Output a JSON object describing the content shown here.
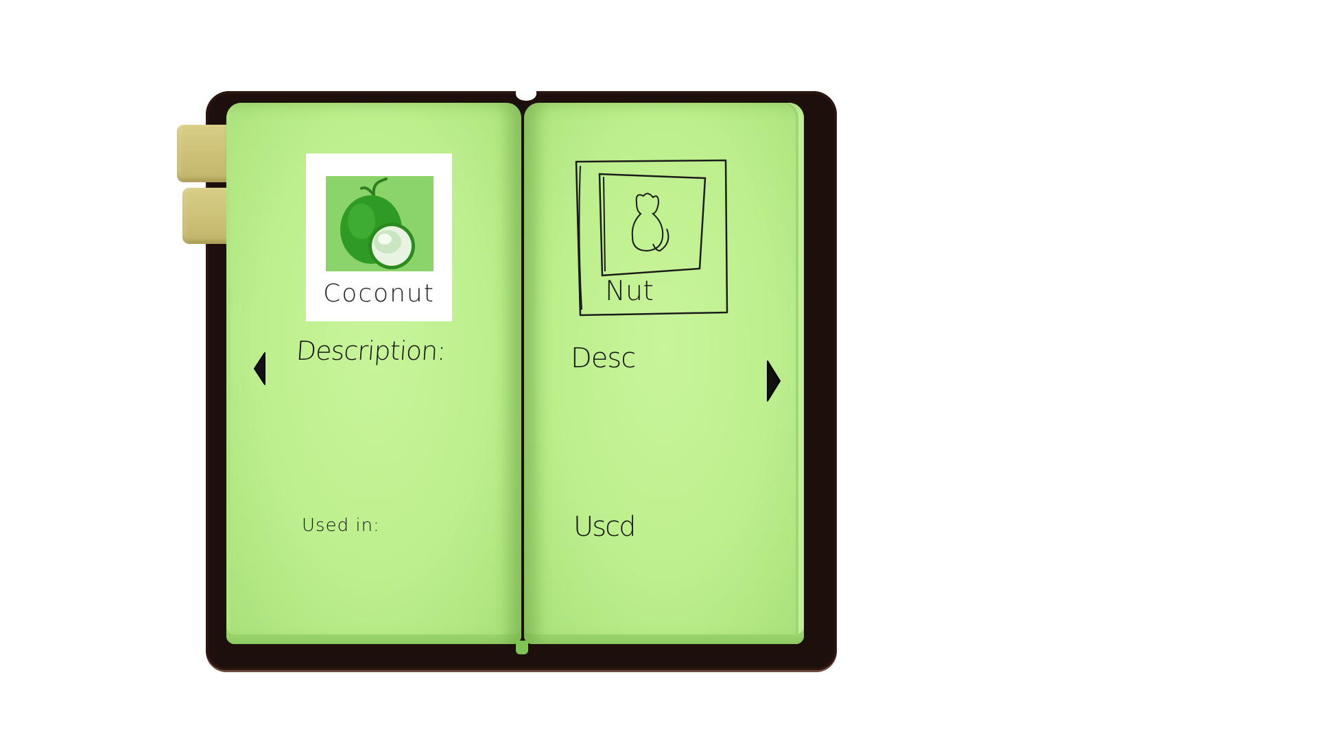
{
  "book": {
    "left_page": {
      "item_name": "Coconut",
      "image_icon": "coconut-icon",
      "description_label": "Description:",
      "used_in_label": "Used in:"
    },
    "right_page": {
      "item_name": "Nut",
      "image_icon": "nut-sketch-icon",
      "description_label": "Desc",
      "used_in_label": "Uscd"
    },
    "navigation": {
      "prev_icon": "triangle-left-icon",
      "next_icon": "triangle-right-icon"
    },
    "bookmarks": [
      "bookmark-tab",
      "bookmark-tab"
    ]
  },
  "colors": {
    "page_green": "#c6f398",
    "cover_dark": "#1c0f0c",
    "bookmark_tan": "#cfc37a",
    "photo_bg": "#8ad46a",
    "coconut_green": "#2f9a24"
  }
}
